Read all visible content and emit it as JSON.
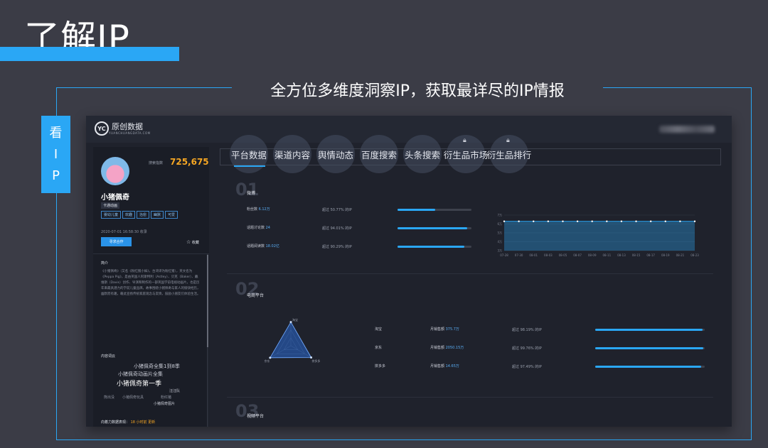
{
  "slide": {
    "title": "了解IP",
    "subtitle": "全方位多维度洞察IP，获取最详尽的IP情报",
    "side_tab": [
      "看",
      "I",
      "P"
    ]
  },
  "app": {
    "logo_mark": "YC",
    "logo_name": "原创数据",
    "logo_domain": "YUANCHUANGDATA.COM"
  },
  "profile": {
    "fans_label": "搜索指数",
    "fans_value": "725,675",
    "name": "小猪佩奇",
    "category": "卡通动画",
    "tags": [
      "婴幼儿童",
      "欢趣",
      "治愈",
      "幽默",
      "可爱"
    ],
    "date": "2020-07-01 16:58:30 收录",
    "find_button": "寻求合作",
    "favorite": "收藏",
    "intro_heading": "简介",
    "intro_text": "《小猪佩奇》（又名《粉红猪小妹》，台湾译为粉红猪），英文名为《Peppa Pig》，是由英国人阿斯特利（Astley）、贝克（Baker）、戴维斯（Davis）创作、导演和制作的一部英国学前电视动画片，也是历年来最具潜力的学前儿童品牌。故事围绕小猪佩奇与家人的愉快经历，幽默而有趣，藉此宣扬传统家庭观念与友情，鼓励小朋友们体验生活。",
    "words_heading": "内容词云",
    "cloud_words": [
      {
        "text": "小猪佩奇全集1到8季",
        "color": "#c9ccd6",
        "size": 7
      },
      {
        "text": "小猪佩奇动画片全集",
        "color": "#c9ccd6",
        "size": 7
      },
      {
        "text": "小猪佩奇第一季",
        "color": "#ffffff",
        "size": 9
      },
      {
        "text": "汪汪队",
        "color": "#c9ccd6",
        "size": 5
      },
      {
        "text": "小猪佩奇玩具",
        "color": "#8c919e",
        "size": 5
      },
      {
        "text": "熊出没",
        "color": "#8c919e",
        "size": 5
      },
      {
        "text": "粉红猪",
        "color": "#8c919e",
        "size": 5
      },
      {
        "text": "小猪佩奇图片",
        "color": "#c9ccd6",
        "size": 5
      }
    ],
    "footer_label": "向着力数据表现：",
    "footer_value": "18 小时前 更新"
  },
  "tabs": [
    {
      "label": "平台数据",
      "locked": false
    },
    {
      "label": "渠道内容",
      "locked": false
    },
    {
      "label": "舆情动态",
      "locked": false
    },
    {
      "label": "百度搜索",
      "locked": false
    },
    {
      "label": "头条搜索",
      "locked": false
    },
    {
      "label": "衍生品市场",
      "locked": true
    },
    {
      "label": "衍生品排行",
      "locked": true
    }
  ],
  "sections": {
    "s1": {
      "num": "01",
      "title": "微博",
      "rows": [
        {
          "label": "粉丝数",
          "value": "6.12万",
          "pct_text": "超过 50.77% 的IP",
          "fill": 0.51
        },
        {
          "label": "话题讨论数",
          "value": "24",
          "pct_text": "超过 94.01% 的IP",
          "fill": 0.94
        },
        {
          "label": "话题阅读数",
          "value": "18.02亿",
          "pct_text": "超过 90.29% 的IP",
          "fill": 0.9
        }
      ]
    },
    "s2": {
      "num": "02",
      "title": "电商平台",
      "rows": [
        {
          "label": "淘宝",
          "sub": "月销售额",
          "value": "375.7万",
          "pct_text": "超过 98.19% 的IP",
          "fill": 0.98
        },
        {
          "label": "京东",
          "sub": "月销售额",
          "value": "2050.15万",
          "pct_text": "超过 99.76% 的IP",
          "fill": 0.99
        },
        {
          "label": "拼多多",
          "sub": "月销售额",
          "value": "14.65万",
          "pct_text": "超过 97.49% 的IP",
          "fill": 0.97
        }
      ]
    },
    "s3": {
      "num": "03",
      "title": "视频平台"
    }
  },
  "chart_data": [
    {
      "type": "area",
      "x": [
        "07-28",
        "07-30",
        "08-01",
        "08-03",
        "08-05",
        "08-07",
        "08-09",
        "08-11",
        "08-13",
        "08-15",
        "08-17",
        "08-19",
        "08-21",
        "08-23"
      ],
      "values": [
        63,
        63,
        63,
        63,
        63,
        63,
        63,
        63,
        63,
        63,
        63,
        63,
        63,
        63
      ],
      "yticks": [
        "7万",
        "6万",
        "5万",
        "4万",
        "3万"
      ],
      "ylim": [
        30,
        70
      ],
      "grid": true,
      "color": "#2aa7f5"
    },
    {
      "type": "radar",
      "axes": [
        "淘宝",
        "京东",
        "拼多多"
      ],
      "values": [
        0.98,
        0.99,
        0.97
      ],
      "color": "#2aa7f5"
    }
  ]
}
